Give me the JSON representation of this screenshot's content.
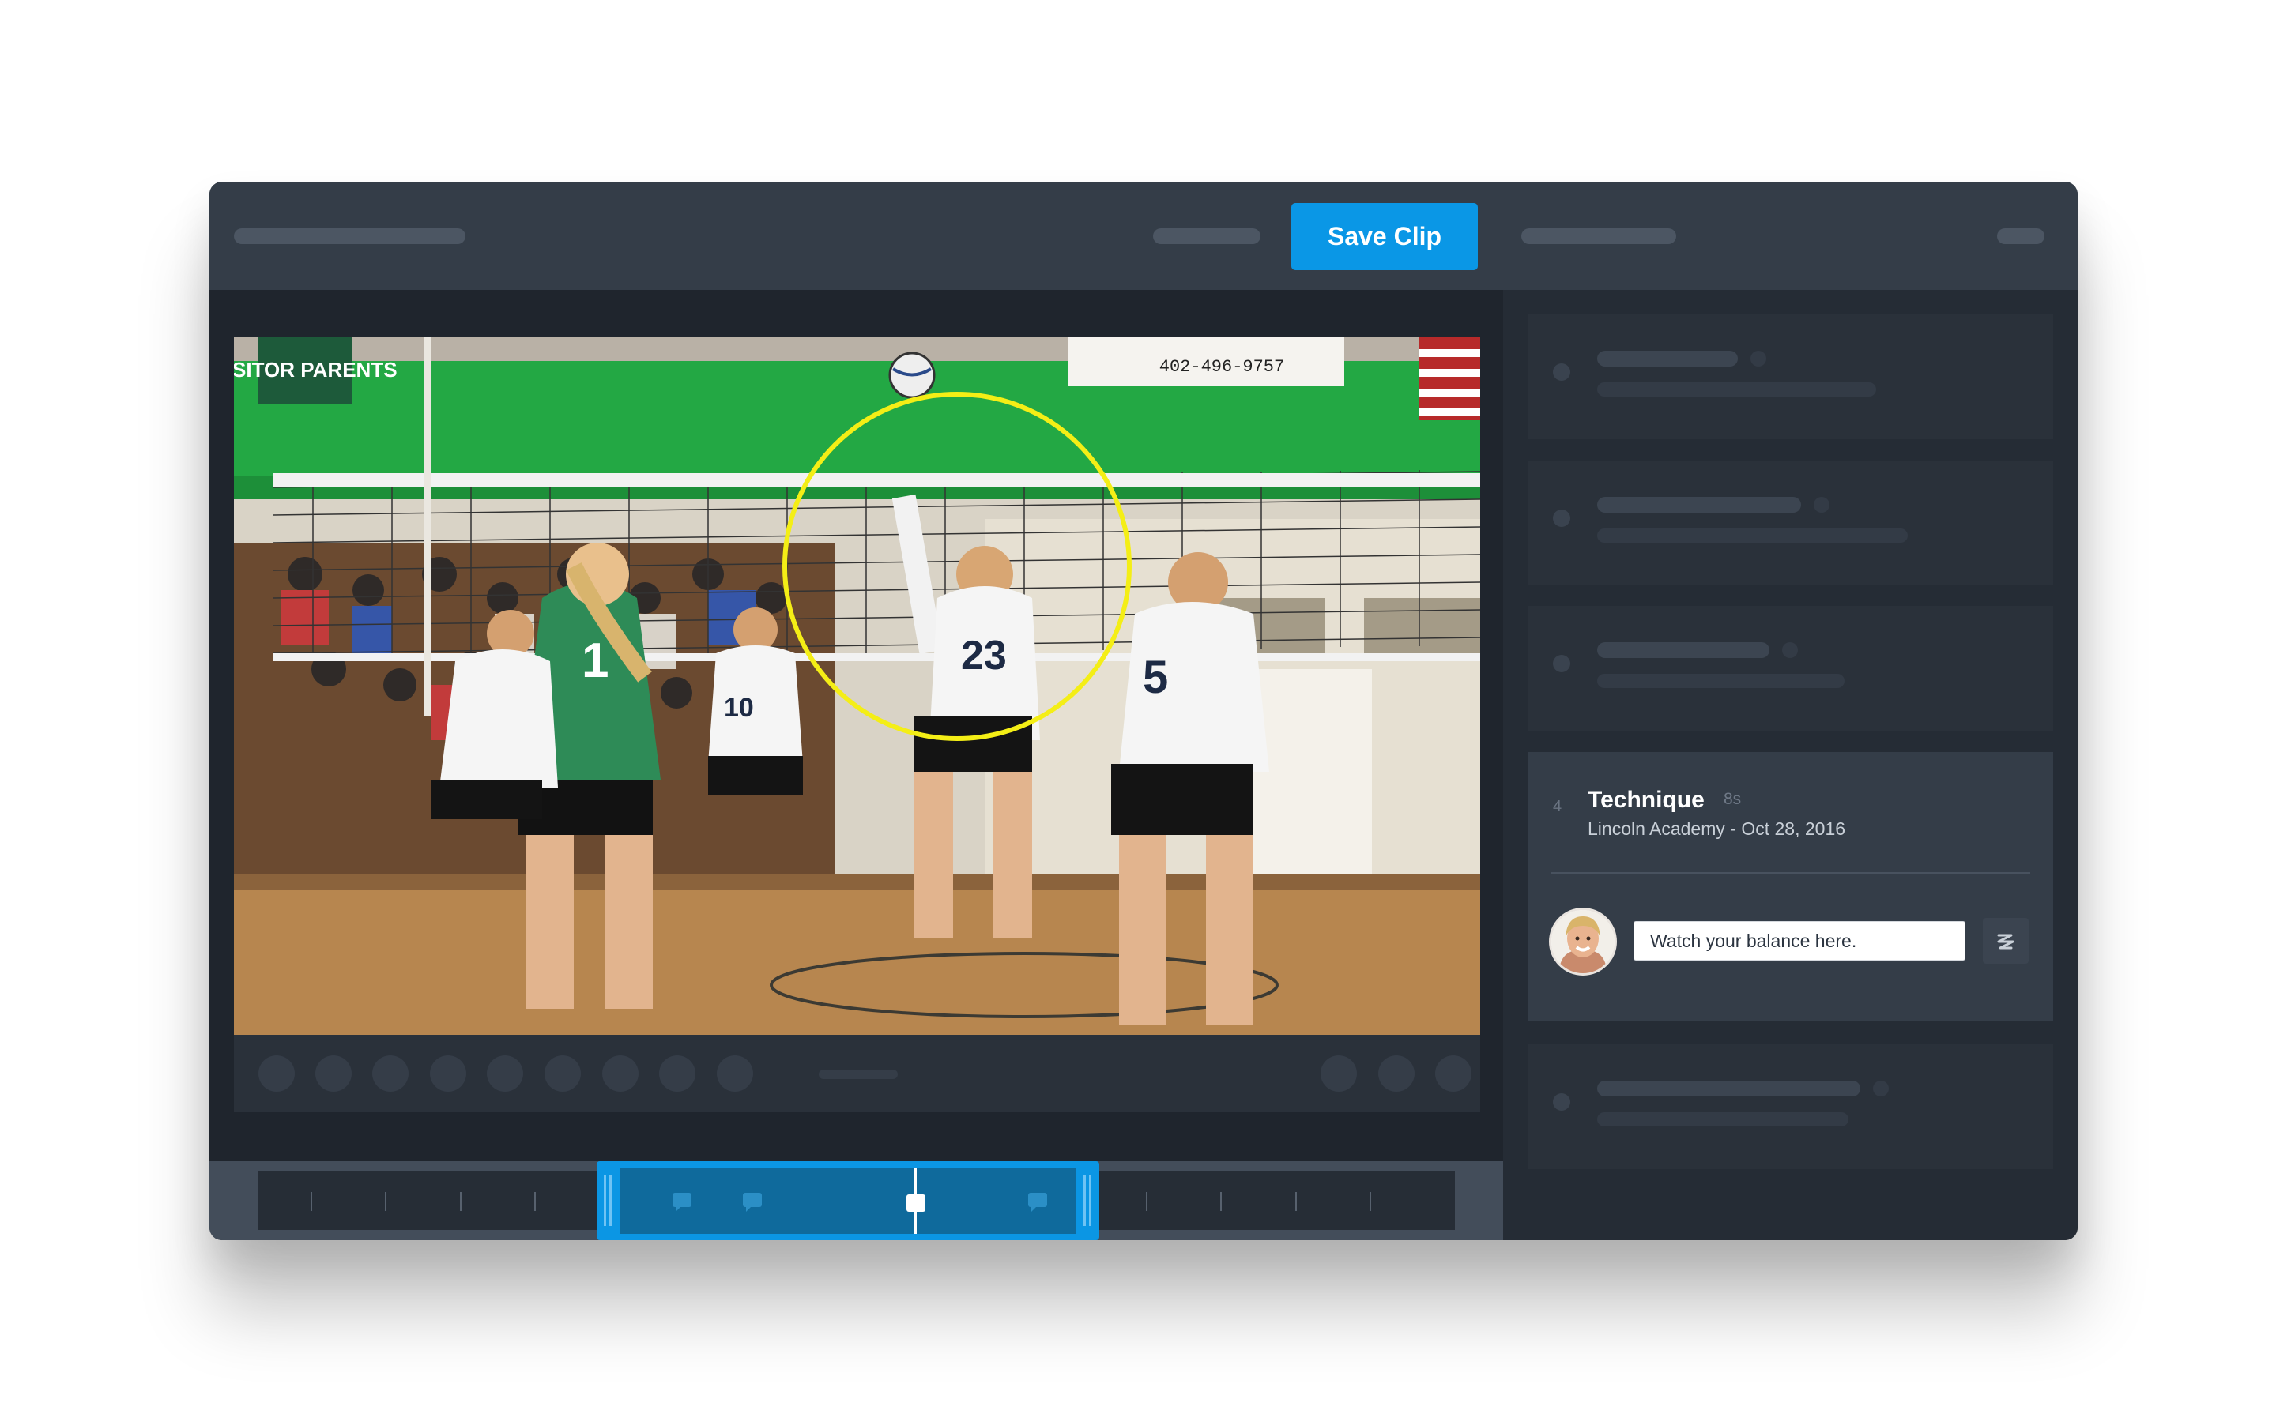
{
  "toolbar": {
    "save_clip_label": "Save Clip"
  },
  "video": {
    "score_board_text": "402-496-9757",
    "banner_text": "VISITOR PARENTS",
    "jersey_numbers": [
      "1",
      "23",
      "5",
      "10"
    ]
  },
  "timeline": {
    "selection_start": 0.29,
    "selection_end": 0.66,
    "playhead": 0.51
  },
  "active_comment": {
    "index": "4",
    "title": "Technique",
    "duration": "8s",
    "subtitle": "Lincoln Academy - Oct 28, 2016",
    "note_value": "Watch your balance here.",
    "note_placeholder": "Watch your balance here."
  },
  "colors": {
    "accent": "#0a97e6",
    "highlight_circle": "#f4ee16",
    "topbar": "#343d48",
    "panel": "#1f252d"
  }
}
